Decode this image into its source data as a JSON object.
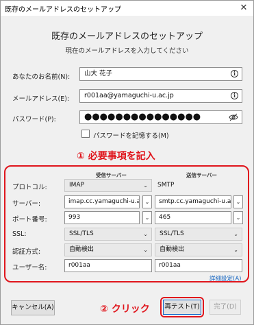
{
  "window": {
    "title": "既存のメールアドレスのセットアップ",
    "close_glyph": "✕"
  },
  "header": {
    "title": "既存のメールアドレスのセットアップ",
    "subtitle": "現在のメールアドレスを入力してください"
  },
  "account": {
    "name_label": "あなたのお名前(N):",
    "name_value": "山大 花子",
    "email_label": "メールアドレス(E):",
    "email_value": "r001aa@yamaguchi-u.ac.jp",
    "password_label": "パスワード(P):",
    "password_value": "●●●●●●●●●●●●●●●",
    "remember_label": "パスワードを記憶する(M)",
    "remember_checked": false,
    "info_glyph": "i",
    "eye_glyph": "👁"
  },
  "annotations": {
    "step1": "① 必要事項を記入",
    "step2": "② クリック",
    "color": "#e0151c"
  },
  "server": {
    "incoming_header": "受信サーバー",
    "outgoing_header": "送信サーバー",
    "rows": {
      "protocol": {
        "label": "プロトコル:",
        "incoming": "IMAP",
        "outgoing": "SMTP"
      },
      "hostname": {
        "label": "サーバー:",
        "incoming": "imap.cc.yamaguchi-u.ac.jp",
        "outgoing": "smtp.cc.yamaguchi-u.ac.jp"
      },
      "port": {
        "label": "ポート番号:",
        "incoming": "993",
        "outgoing": "465"
      },
      "ssl": {
        "label": "SSL:",
        "incoming": "SSL/TLS",
        "outgoing": "SSL/TLS"
      },
      "auth": {
        "label": "認証方式:",
        "incoming": "自動検出",
        "outgoing": "自動検出"
      },
      "username": {
        "label": "ユーザー名:",
        "incoming": "r001aa",
        "outgoing": "r001aa"
      }
    },
    "advanced_link": "詳細設定(A)",
    "chevron_glyph": "⌄"
  },
  "footer": {
    "cancel_label": "キャンセル(A)",
    "retest_label": "再テスト(T)",
    "done_label": "完了(D)"
  }
}
